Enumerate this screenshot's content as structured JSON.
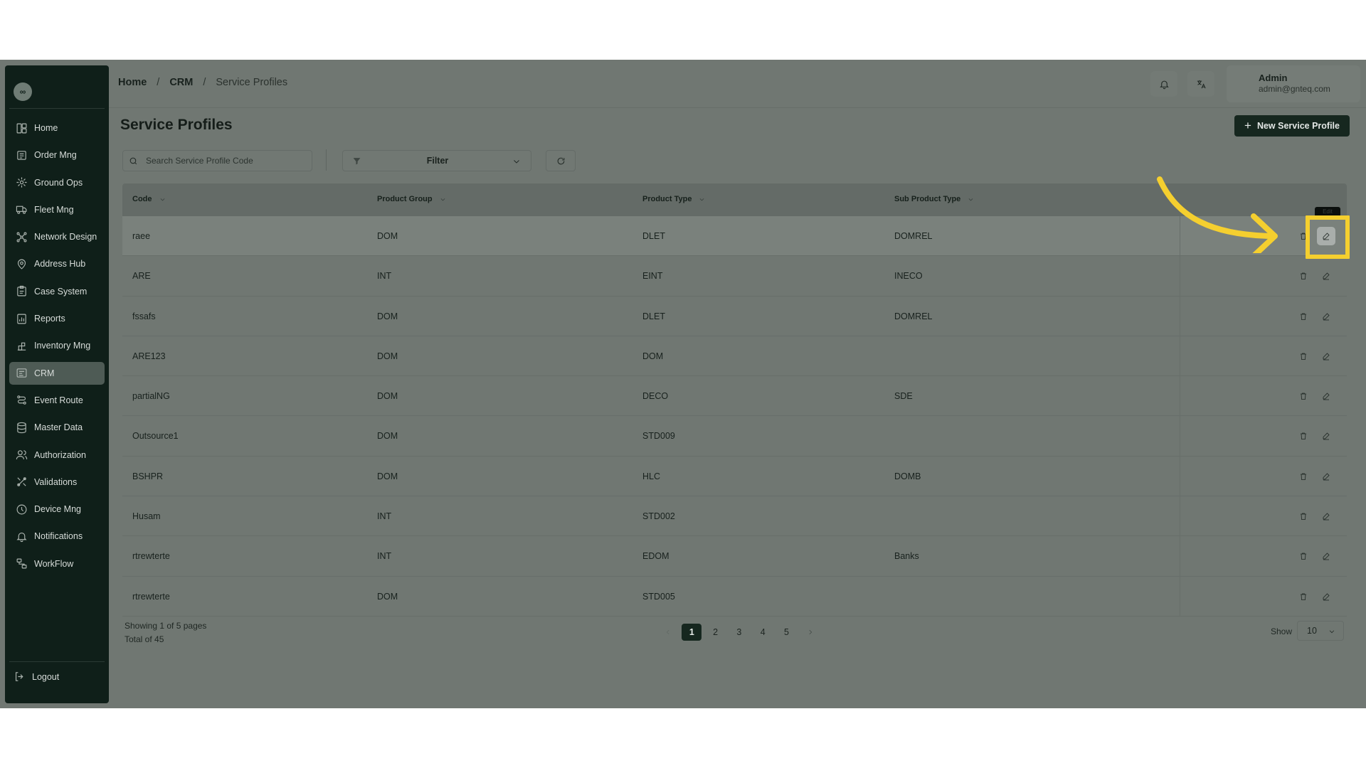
{
  "sidebar": {
    "logo_text": "∞",
    "items": [
      {
        "label": "Home",
        "icon": "layout-icon"
      },
      {
        "label": "Order Mng",
        "icon": "order-icon"
      },
      {
        "label": "Ground Ops",
        "icon": "ground-ops-icon"
      },
      {
        "label": "Fleet Mng",
        "icon": "truck-icon"
      },
      {
        "label": "Network Design",
        "icon": "network-icon"
      },
      {
        "label": "Address Hub",
        "icon": "map-pin-icon"
      },
      {
        "label": "Case System",
        "icon": "case-icon"
      },
      {
        "label": "Reports",
        "icon": "reports-icon"
      },
      {
        "label": "Inventory Mng",
        "icon": "inventory-icon"
      },
      {
        "label": "CRM",
        "icon": "crm-icon",
        "active": true
      },
      {
        "label": "Event Route",
        "icon": "route-icon"
      },
      {
        "label": "Master Data",
        "icon": "database-icon"
      },
      {
        "label": "Authorization",
        "icon": "users-icon"
      },
      {
        "label": "Validations",
        "icon": "validations-icon"
      },
      {
        "label": "Device Mng",
        "icon": "device-icon"
      },
      {
        "label": "Notifications",
        "icon": "bell-icon"
      },
      {
        "label": "WorkFlow",
        "icon": "workflow-icon"
      }
    ],
    "logout_label": "Logout"
  },
  "header": {
    "breadcrumb": {
      "home": "Home",
      "crm": "CRM",
      "current": "Service Profiles",
      "separator": "/"
    },
    "user": {
      "name": "Admin",
      "email": "admin@gnteq.com"
    }
  },
  "page": {
    "title": "Service Profiles",
    "new_button_label": "New Service Profile",
    "search_placeholder": "Search Service Profile Code",
    "filter_label": "Filter"
  },
  "table": {
    "columns": [
      "Code",
      "Product Group",
      "Product Type",
      "Sub Product Type"
    ],
    "rows": [
      {
        "code": "raee",
        "group": "DOM",
        "type": "DLET",
        "sub": "DOMREL"
      },
      {
        "code": "ARE",
        "group": "INT",
        "type": "EINT",
        "sub": "INECO"
      },
      {
        "code": "fssafs",
        "group": "DOM",
        "type": "DLET",
        "sub": "DOMREL"
      },
      {
        "code": "ARE123",
        "group": "DOM",
        "type": "DOM",
        "sub": ""
      },
      {
        "code": "partialNG",
        "group": "DOM",
        "type": "DECO",
        "sub": "SDE"
      },
      {
        "code": "Outsource1",
        "group": "DOM",
        "type": "STD009",
        "sub": ""
      },
      {
        "code": "BSHPR",
        "group": "DOM",
        "type": "HLC",
        "sub": "DOMB"
      },
      {
        "code": "Husam",
        "group": "INT",
        "type": "STD002",
        "sub": ""
      },
      {
        "code": "rtrewterte",
        "group": "INT",
        "type": "EDOM",
        "sub": "Banks"
      },
      {
        "code": "rtrewterte",
        "group": "DOM",
        "type": "STD005",
        "sub": ""
      }
    ],
    "edit_tooltip": "Edit"
  },
  "footer": {
    "showing_text": "Showing 1 of 5 pages",
    "total_text": "Total of 45",
    "pages": [
      "1",
      "2",
      "3",
      "4",
      "5"
    ],
    "current_page": "1",
    "show_label": "Show",
    "page_size": "10"
  },
  "colors": {
    "accent": "#16271f",
    "annotation": "#f5cf2f"
  }
}
